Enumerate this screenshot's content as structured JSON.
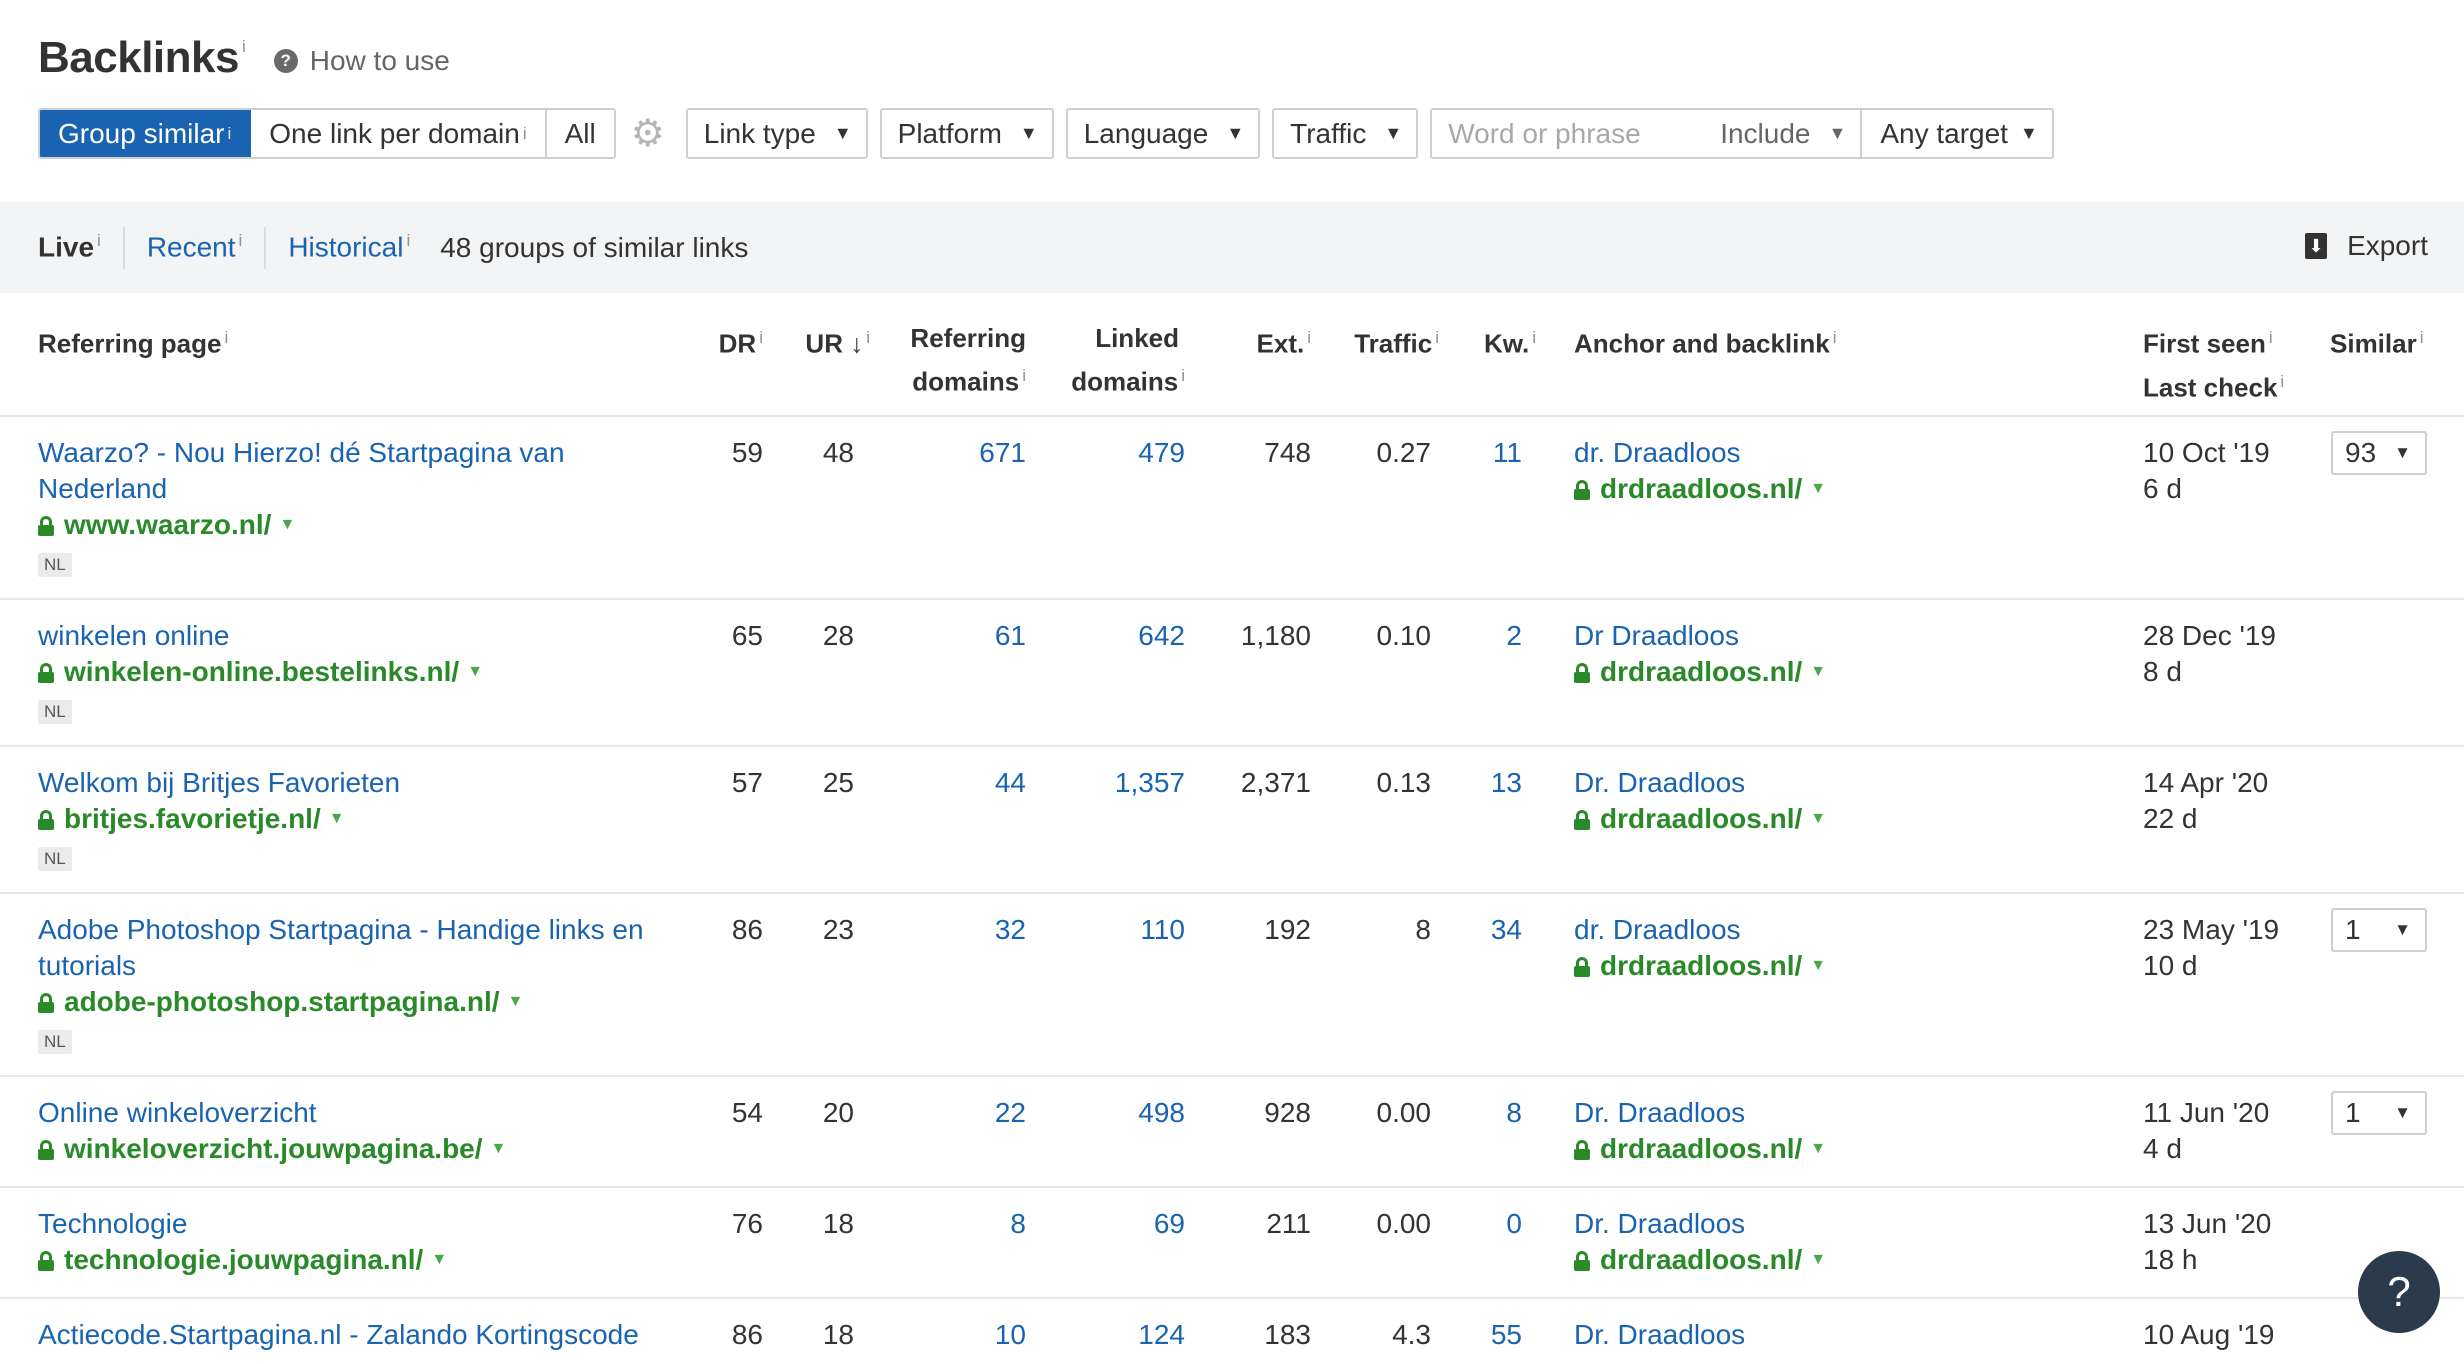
{
  "header": {
    "title": "Backlinks",
    "info": "i",
    "how_to": "How to use"
  },
  "filters": {
    "group_similar": "Group similar",
    "one_link": "One link per domain",
    "all": "All",
    "link_type": "Link type",
    "platform": "Platform",
    "language": "Language",
    "traffic": "Traffic",
    "search_placeholder": "Word or phrase",
    "include": "Include",
    "any_target": "Any target"
  },
  "subbar": {
    "live": "Live",
    "recent": "Recent",
    "historical": "Historical",
    "count": "48 groups of similar links",
    "export": "Export"
  },
  "columns": {
    "referring_page": "Referring page",
    "dr": "DR",
    "ur": "UR",
    "ur_sort": "↓",
    "ref_domains_1": "Referring",
    "ref_domains_2": "domains",
    "linked_domains_1": "Linked",
    "linked_domains_2": "domains",
    "ext": "Ext.",
    "traffic": "Traffic",
    "kw": "Kw.",
    "anchor": "Anchor and backlink",
    "first_seen": "First seen",
    "last_check": "Last check",
    "similar": "Similar"
  },
  "rows": [
    {
      "title1": "Waarzo? - Nou Hierzo! dé Startpagina van",
      "title2": "Nederland",
      "url": "www.waarzo.nl/",
      "lang": "NL",
      "dr": "59",
      "ur": "48",
      "ref": "671",
      "linked": "479",
      "ext": "748",
      "traffic": "0.27",
      "kw": "11",
      "anchor": "dr. Draadloos",
      "target": "drdraadloos.nl/",
      "first": "10 Oct '19",
      "last": "6 d",
      "similar": "93"
    },
    {
      "title1": "winkelen online",
      "title2": "",
      "url": "winkelen-online.bestelinks.nl/",
      "lang": "NL",
      "dr": "65",
      "ur": "28",
      "ref": "61",
      "linked": "642",
      "ext": "1,180",
      "traffic": "0.10",
      "kw": "2",
      "anchor": "Dr Draadloos",
      "target": "drdraadloos.nl/",
      "first": "28 Dec '19",
      "last": "8 d",
      "similar": ""
    },
    {
      "title1": "Welkom bij Britjes Favorieten",
      "title2": "",
      "url": "britjes.favorietje.nl/",
      "lang": "NL",
      "dr": "57",
      "ur": "25",
      "ref": "44",
      "linked": "1,357",
      "ext": "2,371",
      "traffic": "0.13",
      "kw": "13",
      "anchor": "Dr. Draadloos",
      "target": "drdraadloos.nl/",
      "first": "14 Apr '20",
      "last": "22 d",
      "similar": ""
    },
    {
      "title1": "Adobe Photoshop Startpagina - Handige links en",
      "title2": "tutorials",
      "url": "adobe-photoshop.startpagina.nl/",
      "lang": "NL",
      "dr": "86",
      "ur": "23",
      "ref": "32",
      "linked": "110",
      "ext": "192",
      "traffic": "8",
      "kw": "34",
      "anchor": "dr. Draadloos",
      "target": "drdraadloos.nl/",
      "first": "23 May '19",
      "last": "10 d",
      "similar": "1"
    },
    {
      "title1": "Online winkeloverzicht",
      "title2": "",
      "url": "winkeloverzicht.jouwpagina.be/",
      "lang": "",
      "dr": "54",
      "ur": "20",
      "ref": "22",
      "linked": "498",
      "ext": "928",
      "traffic": "0.00",
      "kw": "8",
      "anchor": "Dr. Draadloos",
      "target": "drdraadloos.nl/",
      "first": "11 Jun '20",
      "last": "4 d",
      "similar": "1"
    },
    {
      "title1": "Technologie",
      "title2": "",
      "url": "technologie.jouwpagina.nl/",
      "lang": "",
      "dr": "76",
      "ur": "18",
      "ref": "8",
      "linked": "69",
      "ext": "211",
      "traffic": "0.00",
      "kw": "0",
      "anchor": "Dr. Draadloos",
      "target": "drdraadloos.nl/",
      "first": "13 Jun '20",
      "last": "18 h",
      "similar": ""
    },
    {
      "title1": "Actiecode.Startpagina.nl - Zalando Kortingscode",
      "title2": "",
      "url": "",
      "lang": "",
      "dr": "86",
      "ur": "18",
      "ref": "10",
      "linked": "124",
      "ext": "183",
      "traffic": "4.3",
      "kw": "55",
      "anchor": "Dr. Draadloos",
      "target": "",
      "first": "10 Aug '19",
      "last": "",
      "similar": ""
    }
  ],
  "help": "?"
}
